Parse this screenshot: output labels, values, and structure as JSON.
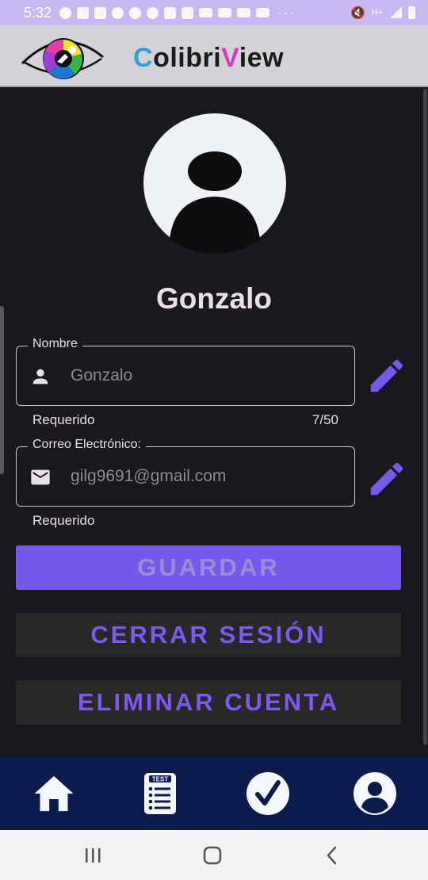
{
  "status_bar": {
    "time": "5:32",
    "more": "···"
  },
  "app": {
    "brand": {
      "c": "C",
      "olibri": "olibri",
      "v": "V",
      "iew": "iew"
    }
  },
  "profile": {
    "name": "Gonzalo"
  },
  "form": {
    "name_field": {
      "label": "Nombre",
      "value": "Gonzalo",
      "helper": "Requerido",
      "counter": "7/50",
      "icon": "person-icon"
    },
    "email_field": {
      "label": "Correo Electrónico:",
      "value": "gilg9691@gmail.com",
      "helper": "Requerido",
      "icon": "mail-icon"
    }
  },
  "buttons": {
    "save": "GUARDAR",
    "logout": "CERRAR SESIÓN",
    "delete": "ELIMINAR CUENTA"
  },
  "bottom_nav": {
    "items": [
      {
        "name": "home",
        "icon": "home-icon"
      },
      {
        "name": "test",
        "icon": "test-icon",
        "badge": "TEST"
      },
      {
        "name": "results",
        "icon": "check-icon"
      },
      {
        "name": "profile",
        "icon": "profile-icon"
      }
    ]
  },
  "colors": {
    "accent": "#7559ec",
    "accent_text": "#7d59ef",
    "nav_bg": "#0c1b4e",
    "background": "#1a171d"
  }
}
